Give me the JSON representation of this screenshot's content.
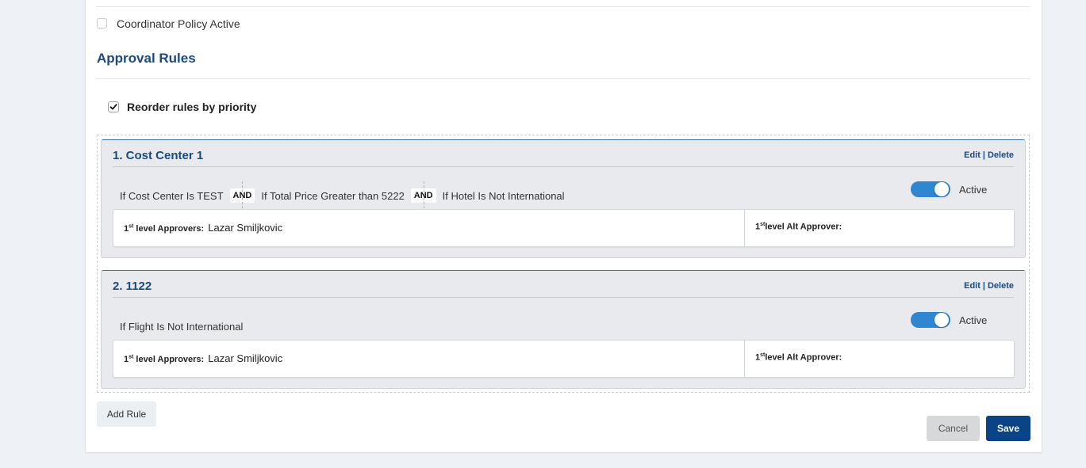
{
  "coordinator": {
    "label": "Coordinator Policy Active",
    "checked": false
  },
  "section": {
    "title": "Approval Rules"
  },
  "reorder": {
    "label": "Reorder rules by priority",
    "checked": true
  },
  "rules": [
    {
      "title": "1. Cost Center 1",
      "edit": "Edit",
      "separator": "|",
      "delete": "Delete",
      "conditions": [
        "If Cost Center Is TEST",
        "If Total Price Greater than 5222",
        "If Hotel Is Not International"
      ],
      "connector": "AND",
      "status": "Active",
      "active": true,
      "approver_sup": "st",
      "approver_label": " level Approvers:",
      "approver_name": "Lazar Smiljkovic",
      "alt_sup": "st",
      "alt_label": "level Alt Approver:"
    },
    {
      "title": "2. 1122",
      "edit": "Edit",
      "separator": "|",
      "delete": "Delete",
      "conditions": [
        "If Flight Is Not International"
      ],
      "status": "Active",
      "active": true,
      "approver_sup": "st",
      "approver_label": " level Approvers:",
      "approver_name": "Lazar Smiljkovic",
      "alt_sup": "st",
      "alt_label": "level Alt Approver:"
    }
  ],
  "buttons": {
    "add_rule": "Add Rule",
    "cancel": "Cancel",
    "save": "Save"
  },
  "colors": {
    "accent": "#1a4a80",
    "toggle": "#2f86d1",
    "save": "#0b4486"
  },
  "icons": {
    "checkmark": "check-icon"
  }
}
